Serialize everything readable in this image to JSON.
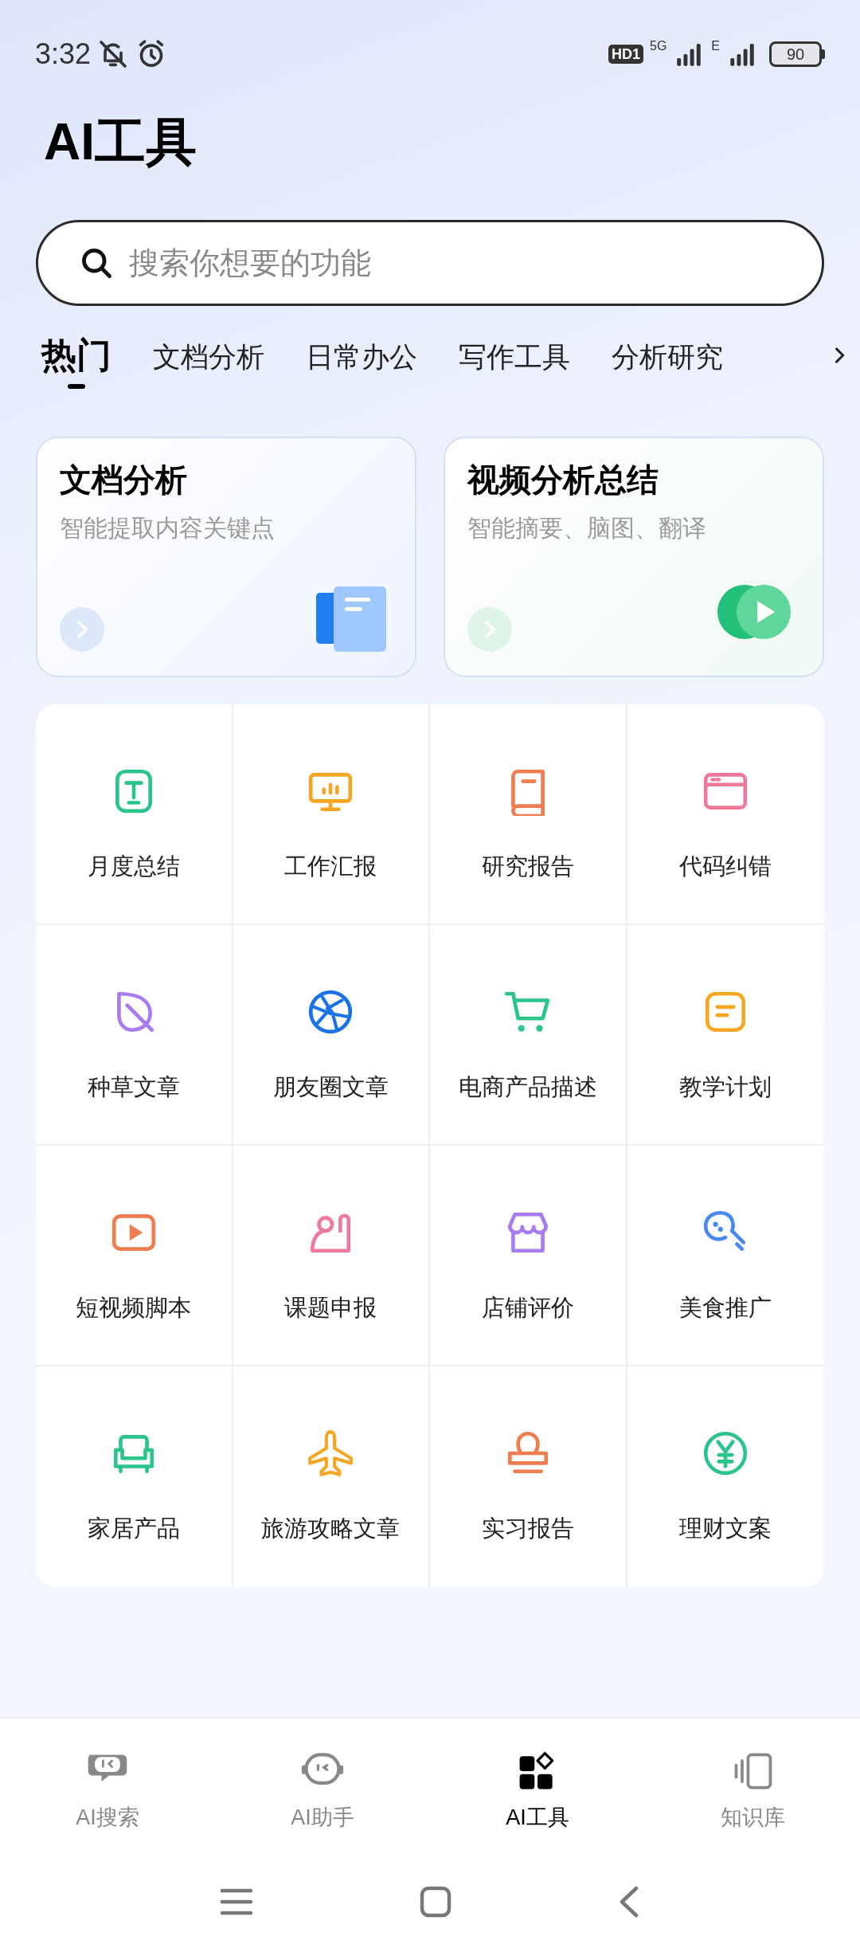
{
  "status_bar": {
    "time": "3:32",
    "hd": "HD1",
    "network_1": "5G",
    "network_2": "E",
    "battery": "90"
  },
  "title": "AI工具",
  "search": {
    "placeholder": "搜索你想要的功能"
  },
  "tabs": [
    {
      "label": "热门",
      "selected": true
    },
    {
      "label": "文档分析",
      "selected": false
    },
    {
      "label": "日常办公",
      "selected": false
    },
    {
      "label": "写作工具",
      "selected": false
    },
    {
      "label": "分析研究",
      "selected": false
    }
  ],
  "feature_cards": [
    {
      "title": "文档分析",
      "subtitle": "智能提取内容关键点",
      "kind": "document"
    },
    {
      "title": "视频分析总结",
      "subtitle": "智能摘要、脑图、翻译",
      "kind": "video"
    }
  ],
  "tools": [
    {
      "label": "月度总结",
      "color": "#2bc48a"
    },
    {
      "label": "工作汇报",
      "color": "#f5a623"
    },
    {
      "label": "研究报告",
      "color": "#f07d4f"
    },
    {
      "label": "代码纠错",
      "color": "#f0789a"
    },
    {
      "label": "种草文章",
      "color": "#a87cf0"
    },
    {
      "label": "朋友圈文章",
      "color": "#1a73e8"
    },
    {
      "label": "电商产品描述",
      "color": "#2bc48a"
    },
    {
      "label": "教学计划",
      "color": "#f5a623"
    },
    {
      "label": "短视频脚本",
      "color": "#f07d4f"
    },
    {
      "label": "课题申报",
      "color": "#f0789a"
    },
    {
      "label": "店铺评价",
      "color": "#a87cf0"
    },
    {
      "label": "美食推广",
      "color": "#4a8af0"
    },
    {
      "label": "家居产品",
      "color": "#2bc48a"
    },
    {
      "label": "旅游攻略文章",
      "color": "#f5a623"
    },
    {
      "label": "实习报告",
      "color": "#f07d4f"
    },
    {
      "label": "理财文案",
      "color": "#2bc48a"
    }
  ],
  "bottom_nav": [
    {
      "label": "AI搜索",
      "selected": false
    },
    {
      "label": "AI助手",
      "selected": false
    },
    {
      "label": "AI工具",
      "selected": true
    },
    {
      "label": "知识库",
      "selected": false
    }
  ]
}
